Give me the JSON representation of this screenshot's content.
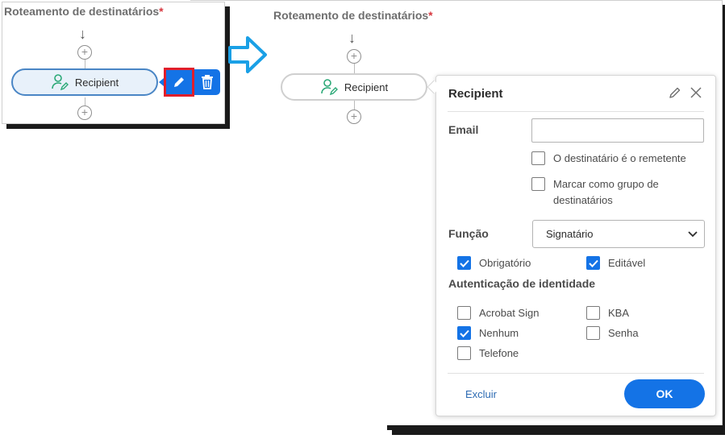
{
  "left": {
    "title": "Roteamento de destinatários",
    "required_mark": "*",
    "node_label": "Recipient",
    "plus": "+",
    "arrow": "↓"
  },
  "right": {
    "title": "Roteamento de destinatários",
    "required_mark": "*",
    "node_label": "Recipient",
    "plus": "+",
    "arrow": "↓"
  },
  "dialog": {
    "title": "Recipient",
    "email_label": "Email",
    "email_value": "",
    "sender_checkbox": "O destinatário é o remetente",
    "sender_checked": false,
    "group_checkbox_line1": "Marcar como grupo de",
    "group_checkbox_line2": "destinatários",
    "group_checked": false,
    "role_label": "Função",
    "role_value": "Signatário",
    "required_checkbox": "Obrigatório",
    "required_checked": true,
    "editable_checkbox": "Editável",
    "editable_checked": true,
    "auth_label": "Autenticação de identidade",
    "auth_options": [
      {
        "label": "Acrobat Sign",
        "checked": false
      },
      {
        "label": "KBA",
        "checked": false
      },
      {
        "label": "Nenhum",
        "checked": true
      },
      {
        "label": "Senha",
        "checked": false
      },
      {
        "label": "Telefone",
        "checked": false
      }
    ],
    "delete_label": "Excluir",
    "ok_label": "OK"
  },
  "colors": {
    "accent": "#1473e6",
    "highlight": "#e01e2b",
    "required": "#d7373f",
    "arrow": "#1aa0e6"
  },
  "icons": [
    "user-edit-icon",
    "pencil-icon",
    "trash-icon",
    "close-icon",
    "chevron-down-icon",
    "check-icon",
    "right-arrow-icon"
  ]
}
